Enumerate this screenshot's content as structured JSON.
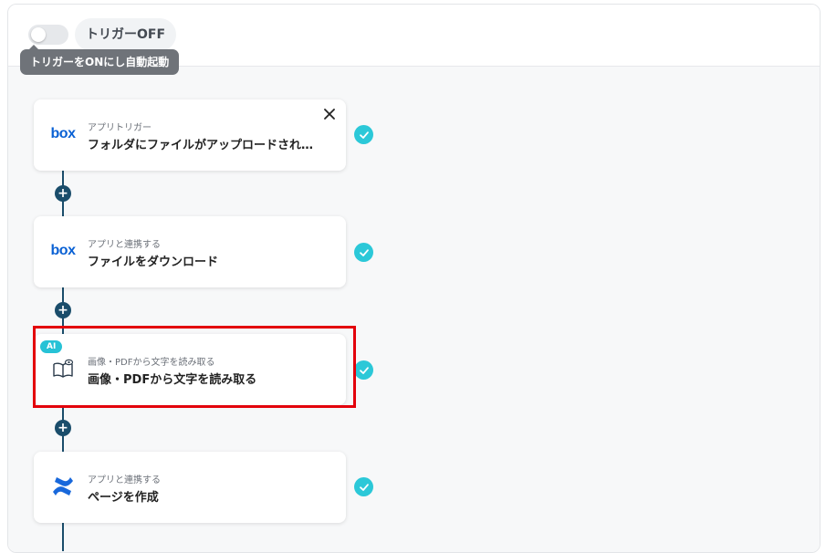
{
  "header": {
    "toggle_state": "off",
    "trigger_label": "トリガーOFF",
    "tooltip": "トリガーをONにし自動起動"
  },
  "steps": [
    {
      "app": "box",
      "icon": "box-logo-icon",
      "subtitle": "アプリトリガー",
      "title": "フォルダにファイルがアップロードされ…",
      "logo_text": "box",
      "closable": true,
      "done": true
    },
    {
      "app": "box",
      "icon": "box-logo-icon",
      "subtitle": "アプリと連携する",
      "title": "ファイルをダウンロード",
      "logo_text": "box",
      "closable": false,
      "done": true
    },
    {
      "app": "ai-ocr",
      "icon": "book-eye-icon",
      "badge": "AI",
      "subtitle": "画像・PDFから文字を読み取る",
      "title": "画像・PDFから文字を読み取る",
      "closable": false,
      "done": true,
      "highlighted": true
    },
    {
      "app": "confluence",
      "icon": "confluence-logo-icon",
      "subtitle": "アプリと連携する",
      "title": "ページを作成",
      "closable": false,
      "done": true
    }
  ],
  "colors": {
    "accent": "#2bc8d8",
    "flow_line": "#1a4d6b",
    "box_brand": "#0a61d4",
    "confluence_brand": "#1868db",
    "highlight": "#e3000b"
  }
}
